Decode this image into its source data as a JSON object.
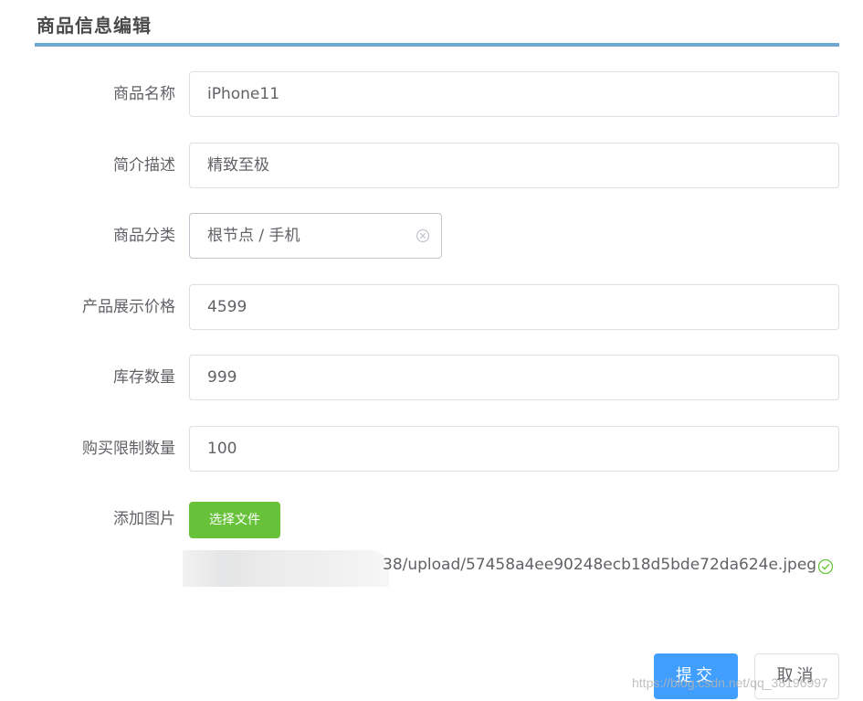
{
  "dialog": {
    "title": "商品信息编辑"
  },
  "form": {
    "name": {
      "label": "商品名称",
      "value": "iPhone11"
    },
    "description": {
      "label": "简介描述",
      "value": "精致至极"
    },
    "category": {
      "label": "商品分类",
      "value": "根节点 / 手机"
    },
    "price": {
      "label": "产品展示价格",
      "value": "4599"
    },
    "stock": {
      "label": "库存数量",
      "value": "999"
    },
    "purchase_limit": {
      "label": "购买限制数量",
      "value": "100"
    },
    "image": {
      "label": "添加图片",
      "button_label": "选择文件",
      "file_name": "38/upload/57458a4ee90248ecb18d5bde72da624e.jpeg",
      "status_icon": "check-circle-icon",
      "status_color": "#67c23a"
    }
  },
  "actions": {
    "submit_label": "提交",
    "cancel_label": "取消"
  },
  "watermark": "https://blog.csdn.net/qq_38196997",
  "colors": {
    "accent_bar": "#6ca8d1",
    "primary": "#409eff",
    "success": "#67c23a"
  }
}
